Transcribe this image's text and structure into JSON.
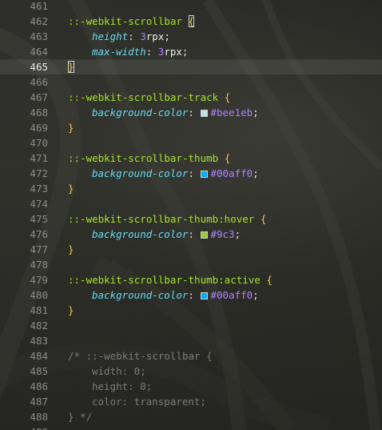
{
  "editor": {
    "colors": {
      "selector": "#a6e22e",
      "brace": "#f2c94c",
      "property": "#66d9ef",
      "value_hex": "#ae81ff",
      "comment": "#7b7d75",
      "line_number": "#8b8d86"
    },
    "current_line": 465,
    "lines": [
      {
        "n": "461"
      },
      {
        "n": "462",
        "sel": "::-webkit-scrollbar",
        "open": "{",
        "brace_highlight": true
      },
      {
        "n": "463",
        "prop": "height",
        "num": "3",
        "unit": "rpx"
      },
      {
        "n": "464",
        "prop": "max-width",
        "num": "3",
        "unit": "rpx"
      },
      {
        "n": "465",
        "close": "}",
        "brace_highlight": true,
        "current": true
      },
      {
        "n": "466"
      },
      {
        "n": "467",
        "sel": "::-webkit-scrollbar-track",
        "open": "{"
      },
      {
        "n": "468",
        "prop": "background-color",
        "swatch": "#bee1eb",
        "hex": "#bee1eb"
      },
      {
        "n": "469",
        "close": "}"
      },
      {
        "n": "470"
      },
      {
        "n": "471",
        "sel": "::-webkit-scrollbar-thumb",
        "open": "{"
      },
      {
        "n": "472",
        "prop": "background-color",
        "swatch": "#00aff0",
        "hex": "#00aff0"
      },
      {
        "n": "473",
        "close": "}"
      },
      {
        "n": "474"
      },
      {
        "n": "475",
        "sel": "::-webkit-scrollbar-thumb:hover",
        "open": "{"
      },
      {
        "n": "476",
        "prop": "background-color",
        "swatch": "#99cc33",
        "hex": "#9c3"
      },
      {
        "n": "477",
        "close": "}"
      },
      {
        "n": "478"
      },
      {
        "n": "479",
        "sel": "::-webkit-scrollbar-thumb:active",
        "open": "{"
      },
      {
        "n": "480",
        "prop": "background-color",
        "swatch": "#00aff0",
        "hex": "#00aff0"
      },
      {
        "n": "481",
        "close": "}"
      },
      {
        "n": "482"
      },
      {
        "n": "483"
      },
      {
        "n": "484",
        "comment": "/* ::-webkit-scrollbar {"
      },
      {
        "n": "485",
        "comment_indent": "width: 0;"
      },
      {
        "n": "486",
        "comment_indent": "height: 0;"
      },
      {
        "n": "487",
        "comment_indent": "color: transparent;"
      },
      {
        "n": "488",
        "comment": "} */"
      },
      {
        "n": "489"
      }
    ]
  }
}
